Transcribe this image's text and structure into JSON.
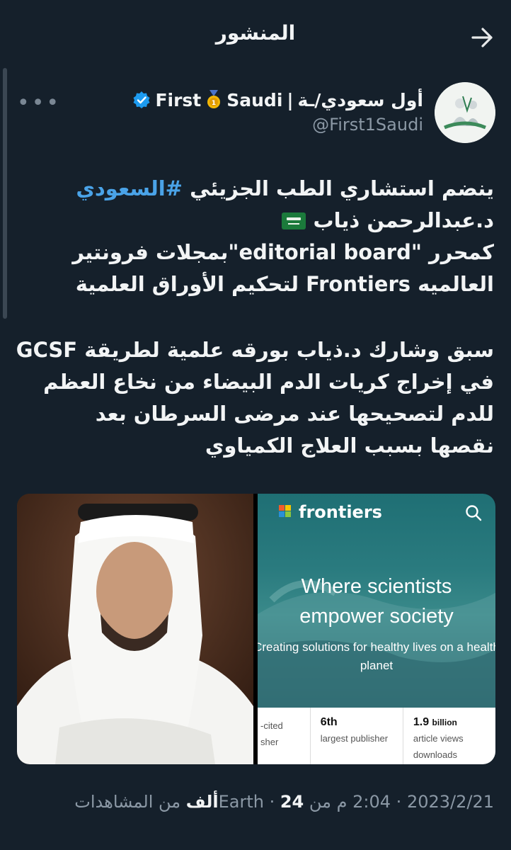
{
  "header": {
    "title": "المنشور",
    "back_icon": "arrow-right-icon"
  },
  "author": {
    "display_name_ar": "أول سعودي/ـة",
    "separator": "|",
    "display_name_en_1": "First",
    "display_name_en_2": "Saudi",
    "handle": "@First1Saudi",
    "verified_color": "#1d9bf0"
  },
  "tweet": {
    "line1_text": "ينضم استشاري الطب الجزيئي ",
    "line1_hashtag": "#السعودي",
    "line2": "د.عبدالرحمن ذياب",
    "line3": "كمحرر \"editorial board\"بمجلات فرونتير",
    "line4": "العالميه Frontiers لتحكيم الأوراق العلمية",
    "line5": "سبق وشارك د.ذياب بورقه علمية لطريقة GCSF",
    "line6": "في إخراج كريات الدم البيضاء من نخاع العظم",
    "line7": "للدم لتصحيحها عند مرضى السرطان بعد",
    "line8": "نقصها بسبب العلاج الكمياوي"
  },
  "media_card": {
    "brand": "frontiers",
    "headline_1": "Where scientists",
    "headline_2": "empower society",
    "sub_1": "Creating solutions for healthy lives on a health",
    "sub_2": "planet",
    "stats": [
      {
        "num": "",
        "lbl1": "-cited",
        "lbl2": "sher"
      },
      {
        "num": "6th",
        "lbl1": "largest publisher",
        "lbl2": ""
      },
      {
        "num": "1.9",
        "unit": "billion",
        "lbl1": "article views",
        "lbl2": "downloads"
      }
    ]
  },
  "meta": {
    "date": "2023/2/21",
    "time": "2:04 م من Earth",
    "views_count": "24ألف",
    "views_label": " من المشاهدات",
    "dot": " · "
  }
}
